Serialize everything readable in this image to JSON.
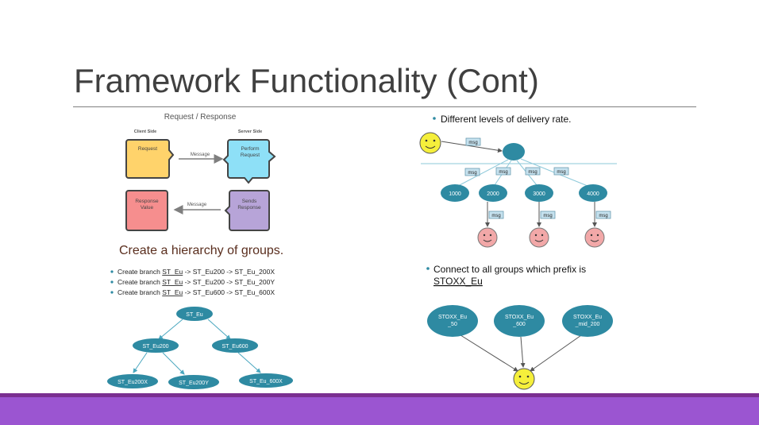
{
  "slide": {
    "title": "Framework Functionality (Cont)"
  },
  "request_response": {
    "title": "Request / Response",
    "client_side": "Client Side",
    "server_side": "Server Side",
    "request": "Request",
    "perform_request": [
      "Perform",
      "Request"
    ],
    "message_top": "Message",
    "message_bottom": "Message",
    "response_value": [
      "Response",
      "Value"
    ],
    "sends_response": [
      "Sends",
      "Response"
    ]
  },
  "hierarchy": {
    "heading": "Create a hierarchy of groups.",
    "bullets": [
      {
        "prefix": "Create branch ",
        "link": "ST_Eu",
        "rest": " -> ST_Eu200 -> ST_Eu_200X"
      },
      {
        "prefix": "Create branch ",
        "link": "ST_Eu",
        "rest": " -> ST_Eu200 -> ST_Eu_200Y"
      },
      {
        "prefix": "Create branch ",
        "link": "ST_Eu",
        "rest": " -> ST_Eu600 -> ST_Eu_600X"
      }
    ],
    "nodes": {
      "root": "ST_Eu",
      "eu200": "ST_Eu200",
      "eu600": "ST_Eu600",
      "eu200x": "ST_Eu200X",
      "eu200y": "ST_Eu200Y",
      "eu600x": "ST_Eu_600X"
    }
  },
  "delivery": {
    "bullet": "Different levels of delivery rate.",
    "msg": "msg",
    "levels": [
      "1000",
      "2000",
      "3000",
      "4000"
    ]
  },
  "connect": {
    "bullet_line1": "Connect to all groups which prefix is",
    "bullet_line2": "STOXX_Eu",
    "groups": [
      [
        "STOXX_Eu",
        "_50"
      ],
      [
        "STOXX_Eu",
        "_600"
      ],
      [
        "STOXX_Eu",
        "_mid_200"
      ]
    ]
  },
  "colors": {
    "node_teal": "#2e8aa2",
    "footer": "#9b55d1",
    "footer_dark": "#7a2f90",
    "request_yellow": "#ffd36b",
    "perform_blue": "#8ee0f7",
    "response_red": "#f68e8e",
    "sends_purple": "#b7a4d8",
    "smiley_yellow": "#f5ef3b",
    "smiley_pink": "#f2a8a8",
    "msg_box": "#c6e2ef"
  }
}
